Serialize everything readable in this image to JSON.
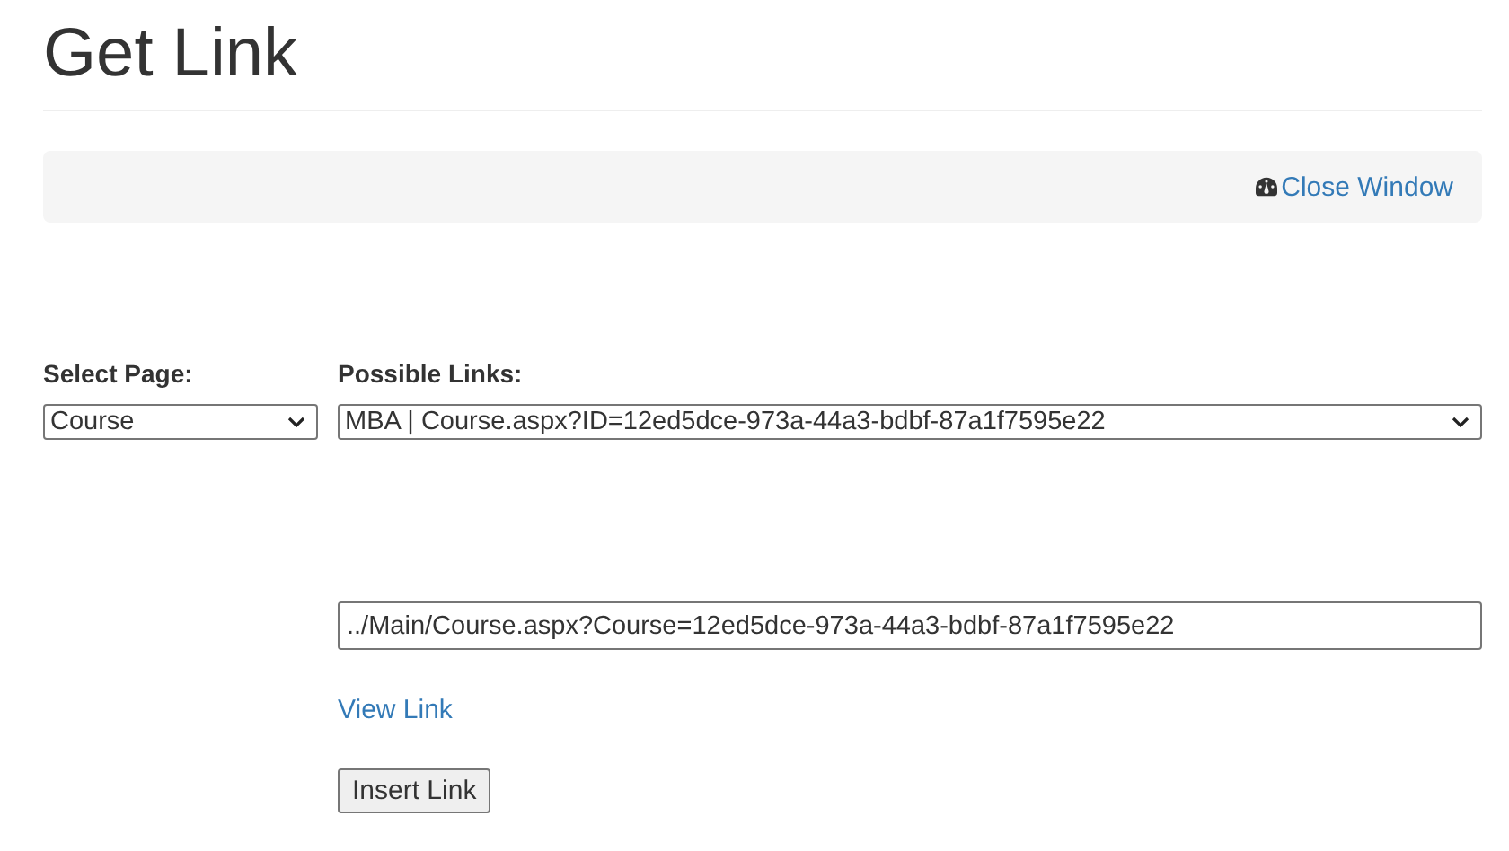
{
  "title": "Get Link",
  "toolbar": {
    "close_link": "Close Window"
  },
  "select_page": {
    "label": "Select Page:",
    "value": "Course"
  },
  "possible_links": {
    "label": "Possible Links:",
    "value": "MBA | Course.aspx?ID=12ed5dce-973a-44a3-bdbf-87a1f7595e22"
  },
  "link_field": {
    "value": "../Main/Course.aspx?Course=12ed5dce-973a-44a3-bdbf-87a1f7595e22"
  },
  "view_link": "View Link",
  "insert_button": "Insert Link"
}
